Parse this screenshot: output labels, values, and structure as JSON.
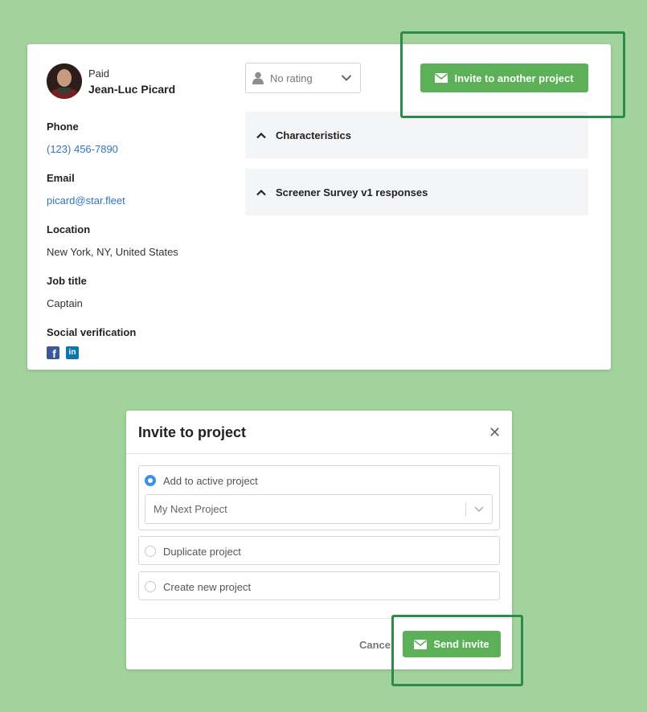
{
  "profile": {
    "status": "Paid",
    "name": "Jean-Luc Picard",
    "fields": [
      {
        "label": "Phone",
        "value": "(123) 456-7890"
      },
      {
        "label": "Email",
        "value": "picard@star.fleet"
      },
      {
        "label": "Location",
        "value": "New York, NY, United States"
      },
      {
        "label": "Job title",
        "value": "Captain"
      }
    ],
    "social_label": "Social verification",
    "social_icons": [
      "facebook-icon",
      "linkedin-icon"
    ]
  },
  "rating": {
    "label": "No rating",
    "icon": "user-icon"
  },
  "invite_button": {
    "label": "Invite to another project",
    "icon": "envelope-icon"
  },
  "sections": [
    {
      "title": "Characteristics",
      "icon": "chevron-up-icon"
    },
    {
      "title": "Screener Survey v1 responses",
      "icon": "chevron-up-icon"
    }
  ],
  "modal": {
    "title": "Invite to project",
    "close_icon": "close-icon",
    "options": [
      {
        "label": "Add to active project",
        "selected": true
      },
      {
        "label": "Duplicate project",
        "selected": false
      },
      {
        "label": "Create new project",
        "selected": false
      }
    ],
    "project_select": {
      "value": "My Next Project"
    },
    "cancel_label": "Cancel",
    "send_label": "Send invite"
  },
  "colors": {
    "background": "#a2d39c",
    "accent_button": "#5cb058",
    "highlight_border": "#2e8a4c",
    "link": "#2f76b8",
    "radio_selected": "#3d8fe8"
  }
}
